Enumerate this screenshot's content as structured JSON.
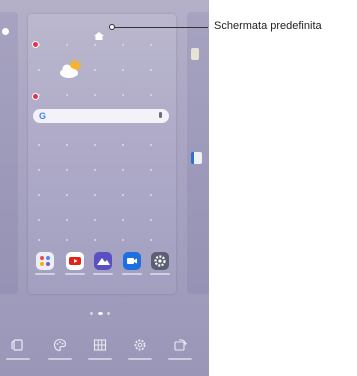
{
  "callout": {
    "label": "Schermata predefinita"
  },
  "search_bar": {
    "logo": "G"
  },
  "dock_apps": [
    {
      "name": "folder-icon",
      "color": "#f0eef5"
    },
    {
      "name": "youtube-icon",
      "color": "#e62117"
    },
    {
      "name": "gallery-icon",
      "color": "#5b4fc4"
    },
    {
      "name": "video-icon",
      "color": "#1f6fe0"
    },
    {
      "name": "settings-icon",
      "color": "#5c5f73"
    }
  ],
  "toolbar": [
    {
      "name": "wallpaper-icon"
    },
    {
      "name": "themes-icon"
    },
    {
      "name": "widgets-icon"
    },
    {
      "name": "home-settings-icon"
    },
    {
      "name": "rotate-icon"
    }
  ],
  "colors": {
    "badge": "#e0344d",
    "background": "#a7a3c1"
  }
}
